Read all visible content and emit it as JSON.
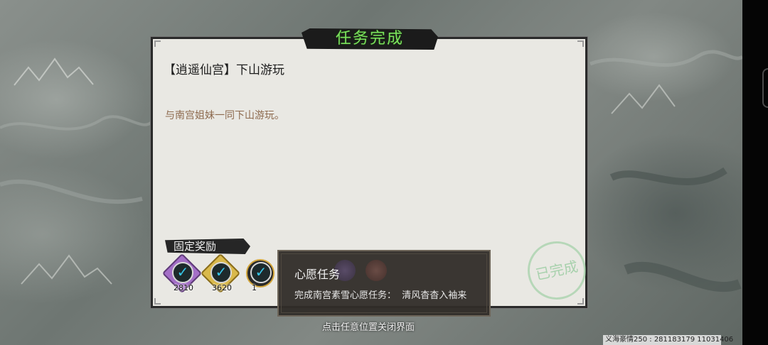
{
  "panel": {
    "title": "任务完成",
    "quest_name": "【逍遥仙宫】下山游玩",
    "description": "与南宫姐妹一同下山游玩。",
    "reward_label": "固定奖励",
    "rewards": [
      {
        "icon": "purple-gem-check-icon",
        "count": "2810",
        "color": "#a46fc7"
      },
      {
        "icon": "gold-gem-check-icon",
        "count": "3620",
        "color": "#d9b94c"
      },
      {
        "icon": "seal-check-icon",
        "count": "1",
        "color": "#222222"
      }
    ],
    "stamp_text": "已完成"
  },
  "tooltip": {
    "title": "心愿任务",
    "body": "完成南宫素雪心愿任务：  清风杳杳入袖来"
  },
  "close_hint": "点击任意位置关闭界面",
  "footer_text": "义海豪情250 : 281183179  11031406",
  "colors": {
    "title_green": "#7be25d",
    "desc_brown": "#8d6a4e",
    "panel_bg": "#e9e8e3"
  }
}
